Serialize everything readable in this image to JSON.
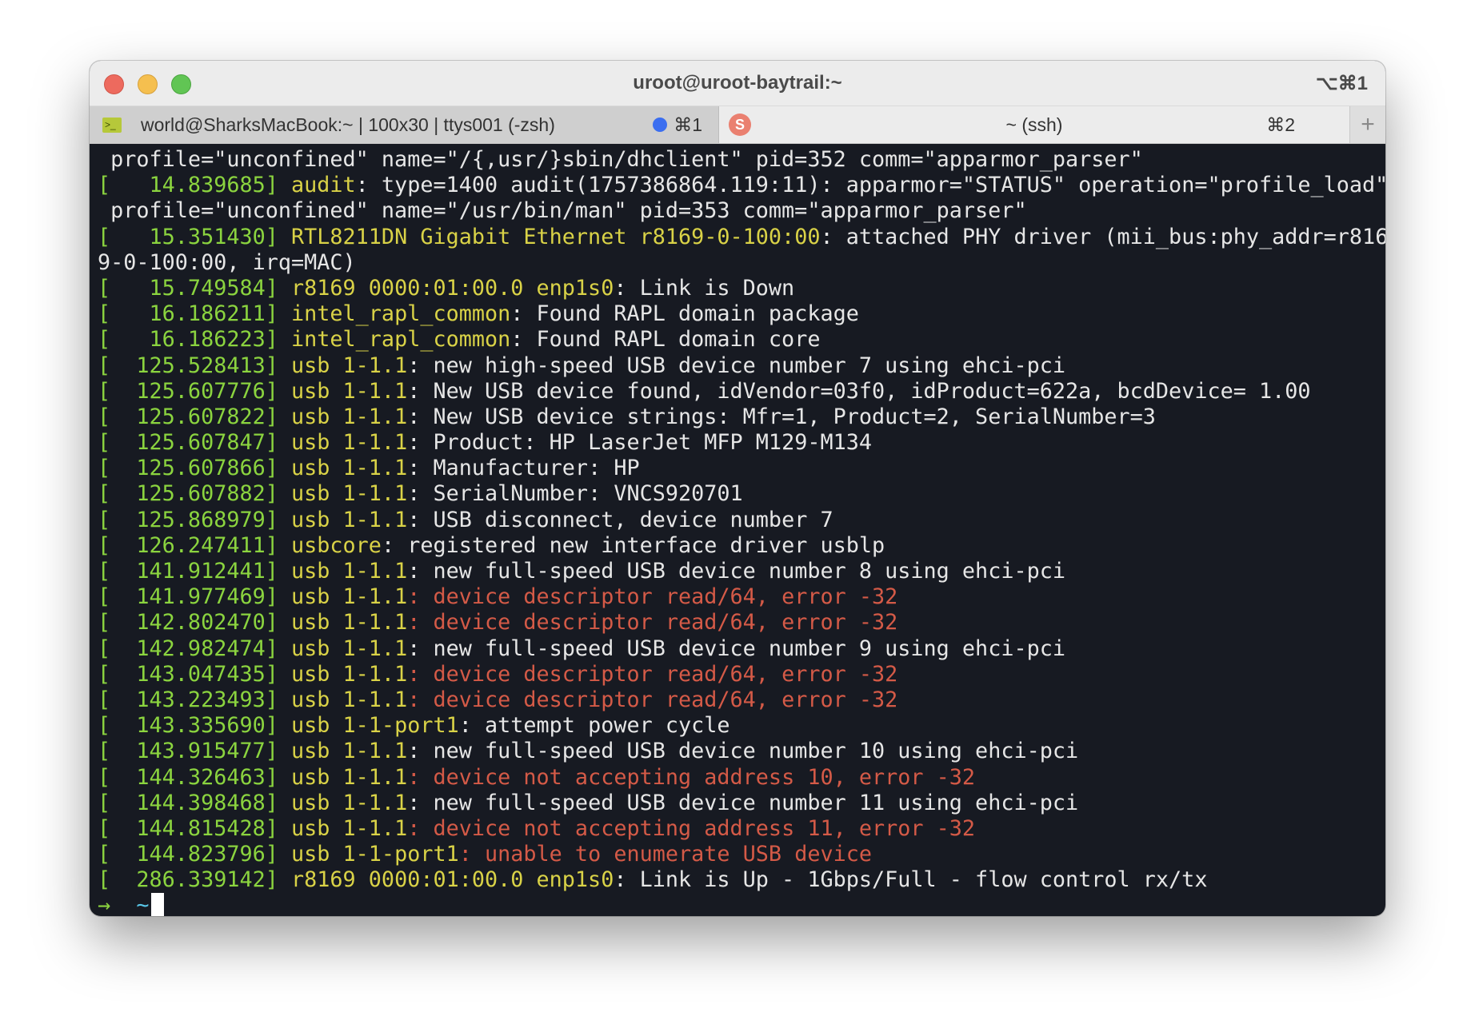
{
  "window": {
    "title": "uroot@uroot-baytrail:~",
    "shortcut": "⌥⌘1"
  },
  "tabs": [
    {
      "label": "world@SharksMacBook:~ | 100x30 | ttys001 (-zsh)",
      "key": "⌘1"
    },
    {
      "label": "~ (ssh)",
      "key": "⌘2",
      "icon": "S"
    }
  ],
  "tab_add_label": "+",
  "terminal": {
    "lines": [
      [
        {
          "c": "w",
          "t": " profile=\"unconfined\" name=\"/{,usr/}sbin/dhclient\" pid=352 comm=\"apparmor_parser\""
        }
      ],
      [
        {
          "c": "g",
          "t": "[   14.839685] "
        },
        {
          "c": "y",
          "t": "audit"
        },
        {
          "c": "w",
          "t": ": type=1400 audit(1757386864.119:11): apparmor=\"STATUS\" operation=\"profile_load\""
        }
      ],
      [
        {
          "c": "w",
          "t": " profile=\"unconfined\" name=\"/usr/bin/man\" pid=353 comm=\"apparmor_parser\""
        }
      ],
      [
        {
          "c": "g",
          "t": "[   15.351430] "
        },
        {
          "c": "y",
          "t": "RTL8211DN Gigabit Ethernet r8169-0-100:00"
        },
        {
          "c": "w",
          "t": ": attached PHY driver (mii_bus:phy_addr=r816"
        }
      ],
      [
        {
          "c": "w",
          "t": "9-0-100:00, irq=MAC)"
        }
      ],
      [
        {
          "c": "g",
          "t": "[   15.749584] "
        },
        {
          "c": "y",
          "t": "r8169 0000:01:00.0 enp1s0"
        },
        {
          "c": "w",
          "t": ": Link is Down"
        }
      ],
      [
        {
          "c": "g",
          "t": "[   16.186211] "
        },
        {
          "c": "y",
          "t": "intel_rapl_common"
        },
        {
          "c": "w",
          "t": ": Found RAPL domain package"
        }
      ],
      [
        {
          "c": "g",
          "t": "[   16.186223] "
        },
        {
          "c": "y",
          "t": "intel_rapl_common"
        },
        {
          "c": "w",
          "t": ": Found RAPL domain core"
        }
      ],
      [
        {
          "c": "g",
          "t": "[  125.528413] "
        },
        {
          "c": "y",
          "t": "usb 1-1.1"
        },
        {
          "c": "w",
          "t": ": new high-speed USB device number 7 using ehci-pci"
        }
      ],
      [
        {
          "c": "g",
          "t": "[  125.607776] "
        },
        {
          "c": "y",
          "t": "usb 1-1.1"
        },
        {
          "c": "w",
          "t": ": New USB device found, idVendor=03f0, idProduct=622a, bcdDevice= 1.00"
        }
      ],
      [
        {
          "c": "g",
          "t": "[  125.607822] "
        },
        {
          "c": "y",
          "t": "usb 1-1.1"
        },
        {
          "c": "w",
          "t": ": New USB device strings: Mfr=1, Product=2, SerialNumber=3"
        }
      ],
      [
        {
          "c": "g",
          "t": "[  125.607847] "
        },
        {
          "c": "y",
          "t": "usb 1-1.1"
        },
        {
          "c": "w",
          "t": ": Product: HP LaserJet MFP M129-M134"
        }
      ],
      [
        {
          "c": "g",
          "t": "[  125.607866] "
        },
        {
          "c": "y",
          "t": "usb 1-1.1"
        },
        {
          "c": "w",
          "t": ": Manufacturer: HP"
        }
      ],
      [
        {
          "c": "g",
          "t": "[  125.607882] "
        },
        {
          "c": "y",
          "t": "usb 1-1.1"
        },
        {
          "c": "w",
          "t": ": SerialNumber: VNCS920701"
        }
      ],
      [
        {
          "c": "g",
          "t": "[  125.868979] "
        },
        {
          "c": "y",
          "t": "usb 1-1.1"
        },
        {
          "c": "w",
          "t": ": USB disconnect, device number 7"
        }
      ],
      [
        {
          "c": "g",
          "t": "[  126.247411] "
        },
        {
          "c": "y",
          "t": "usbcore"
        },
        {
          "c": "w",
          "t": ": registered new interface driver usblp"
        }
      ],
      [
        {
          "c": "g",
          "t": "[  141.912441] "
        },
        {
          "c": "y",
          "t": "usb 1-1.1"
        },
        {
          "c": "w",
          "t": ": new full-speed USB device number 8 using ehci-pci"
        }
      ],
      [
        {
          "c": "g",
          "t": "[  141.977469] "
        },
        {
          "c": "y",
          "t": "usb 1-1.1"
        },
        {
          "c": "r",
          "t": ": device descriptor read/64, error -32"
        }
      ],
      [
        {
          "c": "g",
          "t": "[  142.802470] "
        },
        {
          "c": "y",
          "t": "usb 1-1.1"
        },
        {
          "c": "r",
          "t": ": device descriptor read/64, error -32"
        }
      ],
      [
        {
          "c": "g",
          "t": "[  142.982474] "
        },
        {
          "c": "y",
          "t": "usb 1-1.1"
        },
        {
          "c": "w",
          "t": ": new full-speed USB device number 9 using ehci-pci"
        }
      ],
      [
        {
          "c": "g",
          "t": "[  143.047435] "
        },
        {
          "c": "y",
          "t": "usb 1-1.1"
        },
        {
          "c": "r",
          "t": ": device descriptor read/64, error -32"
        }
      ],
      [
        {
          "c": "g",
          "t": "[  143.223493] "
        },
        {
          "c": "y",
          "t": "usb 1-1.1"
        },
        {
          "c": "r",
          "t": ": device descriptor read/64, error -32"
        }
      ],
      [
        {
          "c": "g",
          "t": "[  143.335690] "
        },
        {
          "c": "y",
          "t": "usb 1-1-port1"
        },
        {
          "c": "w",
          "t": ": attempt power cycle"
        }
      ],
      [
        {
          "c": "g",
          "t": "[  143.915477] "
        },
        {
          "c": "y",
          "t": "usb 1-1.1"
        },
        {
          "c": "w",
          "t": ": new full-speed USB device number 10 using ehci-pci"
        }
      ],
      [
        {
          "c": "g",
          "t": "[  144.326463] "
        },
        {
          "c": "y",
          "t": "usb 1-1.1"
        },
        {
          "c": "r",
          "t": ": device not accepting address 10, error -32"
        }
      ],
      [
        {
          "c": "g",
          "t": "[  144.398468] "
        },
        {
          "c": "y",
          "t": "usb 1-1.1"
        },
        {
          "c": "w",
          "t": ": new full-speed USB device number 11 using ehci-pci"
        }
      ],
      [
        {
          "c": "g",
          "t": "[  144.815428] "
        },
        {
          "c": "y",
          "t": "usb 1-1.1"
        },
        {
          "c": "r",
          "t": ": device not accepting address 11, error -32"
        }
      ],
      [
        {
          "c": "g",
          "t": "[  144.823796] "
        },
        {
          "c": "y",
          "t": "usb 1-1-port1"
        },
        {
          "c": "r",
          "t": ": unable to enumerate USB device"
        }
      ],
      [
        {
          "c": "g",
          "t": "[  286.339142] "
        },
        {
          "c": "y",
          "t": "r8169 0000:01:00.0 enp1s0"
        },
        {
          "c": "w",
          "t": ": Link is Up - 1Gbps/Full - flow control rx/tx"
        }
      ]
    ],
    "prompt": {
      "arrow": "→",
      "dir": "~"
    }
  }
}
